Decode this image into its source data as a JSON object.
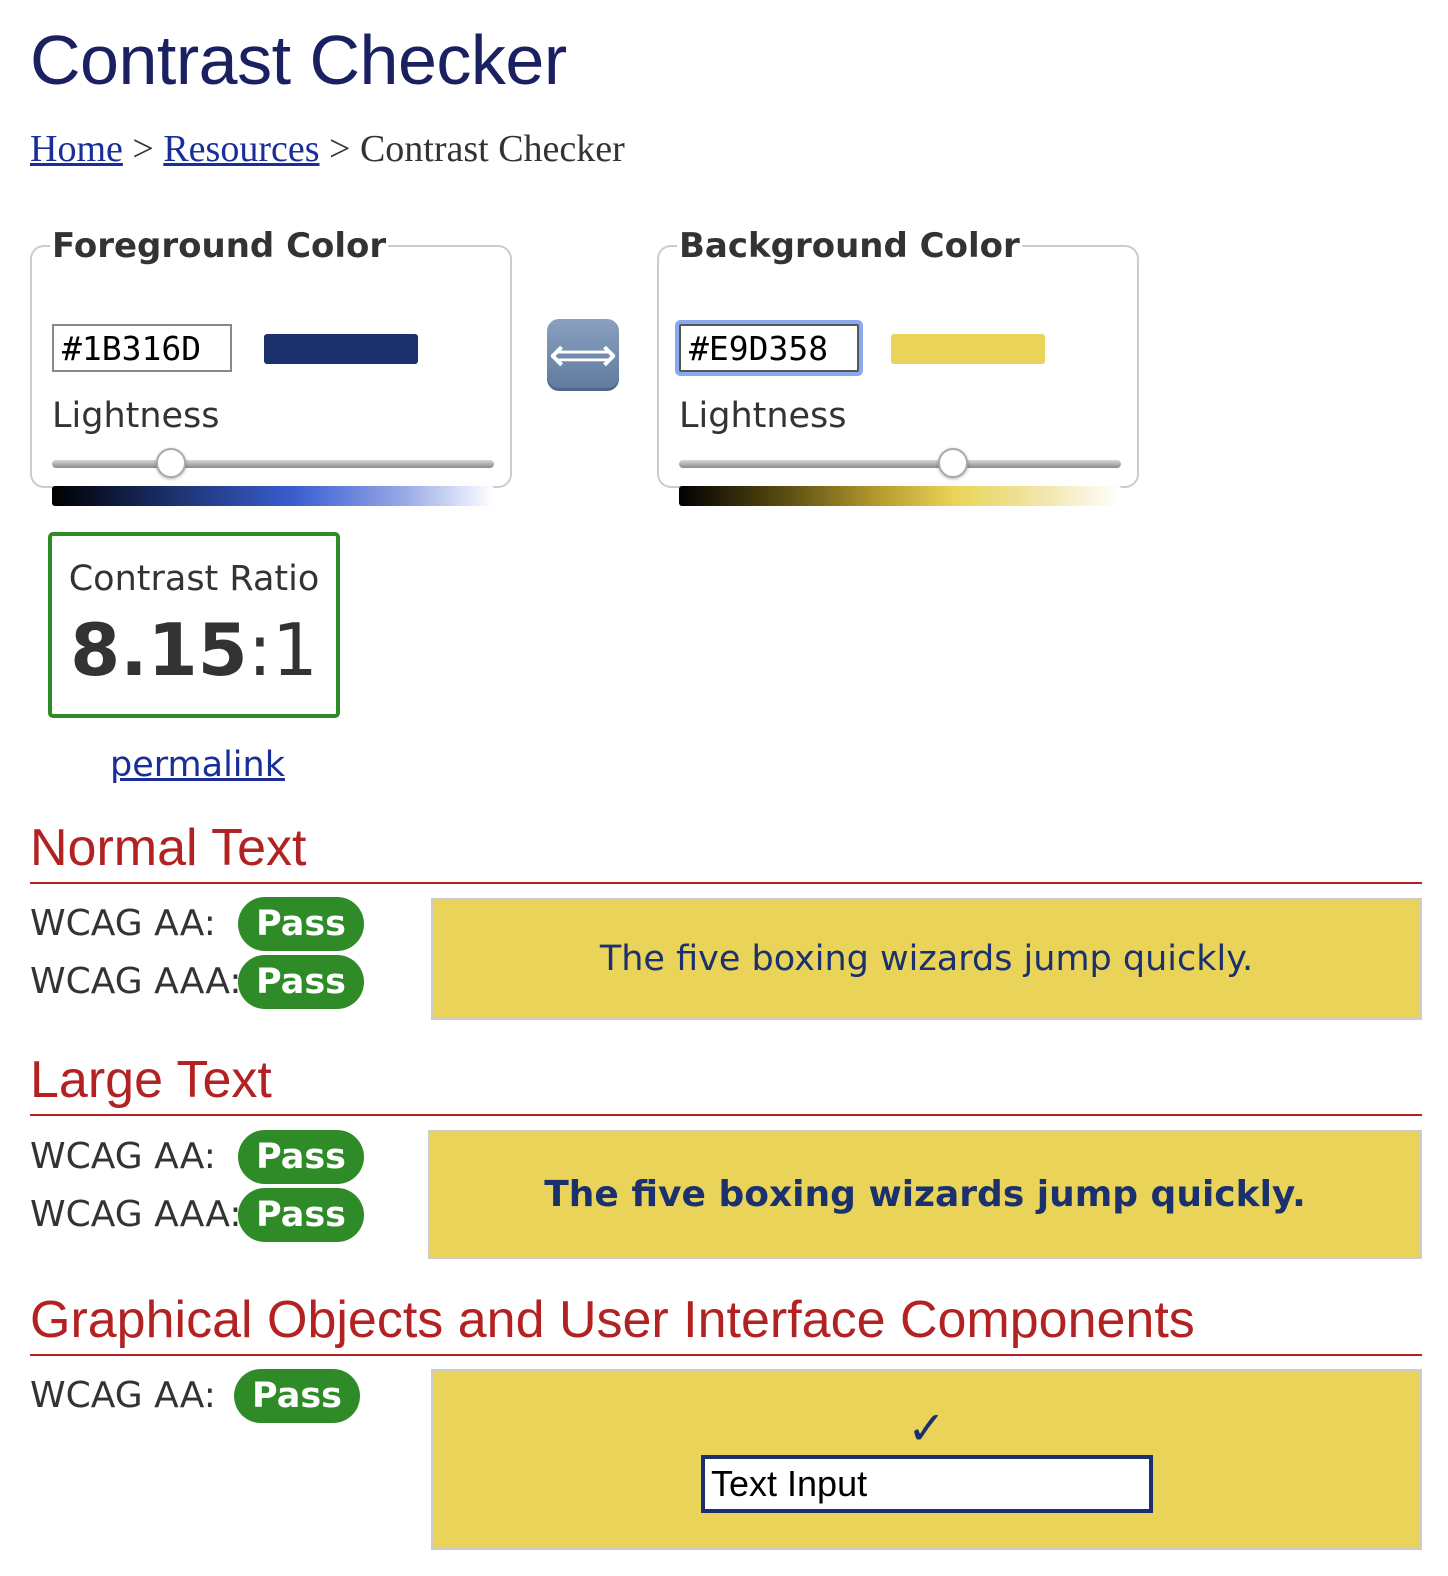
{
  "page": {
    "title": "Contrast Checker"
  },
  "breadcrumb": {
    "home": "Home",
    "sep1": ">",
    "resources": "Resources",
    "sep2": ">",
    "current": "Contrast Checker"
  },
  "foreground": {
    "legend": "Foreground Color",
    "hex": "#1B316D",
    "swatch_color": "#1B316D",
    "lightness_label": "Lightness",
    "lightness_level": 0.27
  },
  "background": {
    "legend": "Background Color",
    "hex": "#E9D358",
    "swatch_color": "#E9D358",
    "lightness_label": "Lightness",
    "lightness_level": 0.62
  },
  "swap": {
    "icon": "swap-arrows-icon",
    "glyph": "⟺"
  },
  "ratio": {
    "label": "Contrast Ratio",
    "value": "8.15",
    "suffix": ":1",
    "border_color": "#2E8B28"
  },
  "permalink": "permalink",
  "colors": {
    "pass": "#2E8B28",
    "heading": "#B22222",
    "link": "#1A2E99"
  },
  "sections": {
    "normal": {
      "heading": "Normal Text",
      "aa_label": "WCAG AA:",
      "aa_result": "Pass",
      "aaa_label": "WCAG AAA:",
      "aaa_result": "Pass",
      "sample": "The five boxing wizards jump quickly."
    },
    "large": {
      "heading": "Large Text",
      "aa_label": "WCAG AA:",
      "aa_result": "Pass",
      "aaa_label": "WCAG AAA:",
      "aaa_result": "Pass",
      "sample": "The five boxing wizards jump quickly."
    },
    "graphical": {
      "heading": "Graphical Objects and User Interface Components",
      "aa_label": "WCAG AA:",
      "aa_result": "Pass",
      "check_glyph": "✓",
      "input_value": "Text Input"
    }
  }
}
